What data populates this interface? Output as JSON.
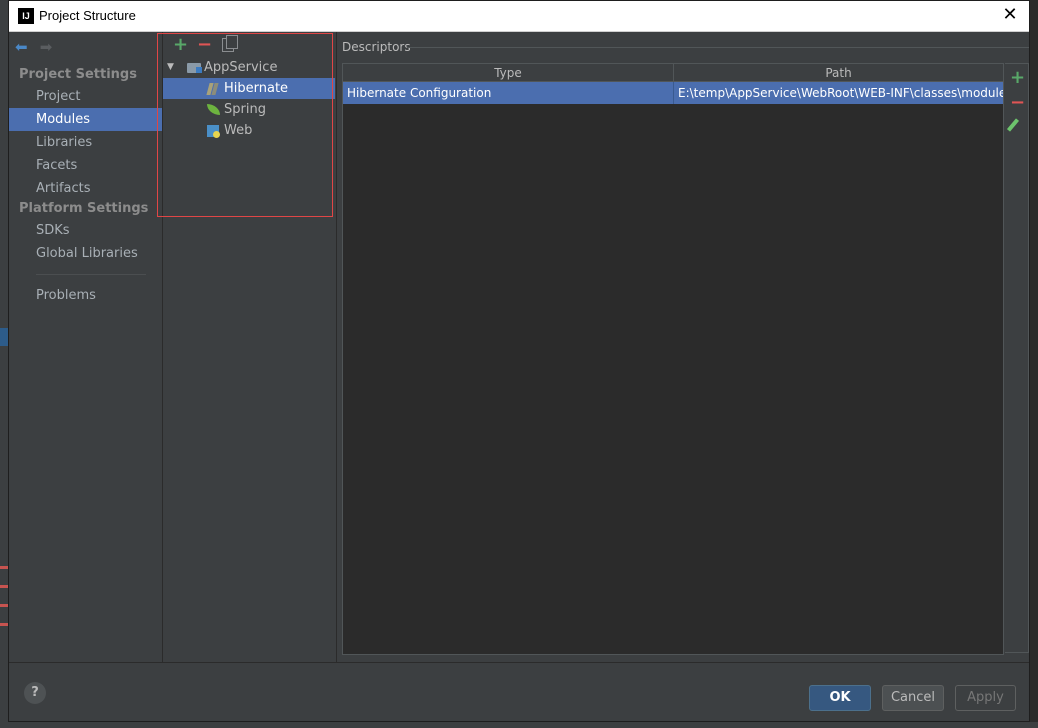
{
  "window": {
    "title": "Project Structure",
    "app_icon_letters": "IJ"
  },
  "sidebar": {
    "sections": [
      {
        "title": "Project Settings",
        "items": [
          "Project",
          "Modules",
          "Libraries",
          "Facets",
          "Artifacts"
        ]
      },
      {
        "title": "Platform Settings",
        "items": [
          "SDKs",
          "Global Libraries"
        ]
      }
    ],
    "problems": "Problems",
    "selected": "Modules"
  },
  "tree": {
    "root": "AppService",
    "children": [
      "Hibernate",
      "Spring",
      "Web"
    ],
    "selected": "Hibernate"
  },
  "descriptors": {
    "legend": "Descriptors",
    "columns": [
      "Type",
      "Path"
    ],
    "rows": [
      {
        "type": "Hibernate Configuration",
        "path": "E:\\temp\\AppService\\WebRoot\\WEB-INF\\classes\\module"
      }
    ]
  },
  "buttons": {
    "help": "?",
    "ok": "OK",
    "cancel": "Cancel",
    "apply": "Apply"
  },
  "colors": {
    "selection": "#4b6eaf",
    "add": "#59a869",
    "remove": "#e05555",
    "highlight_box": "#e04646"
  }
}
